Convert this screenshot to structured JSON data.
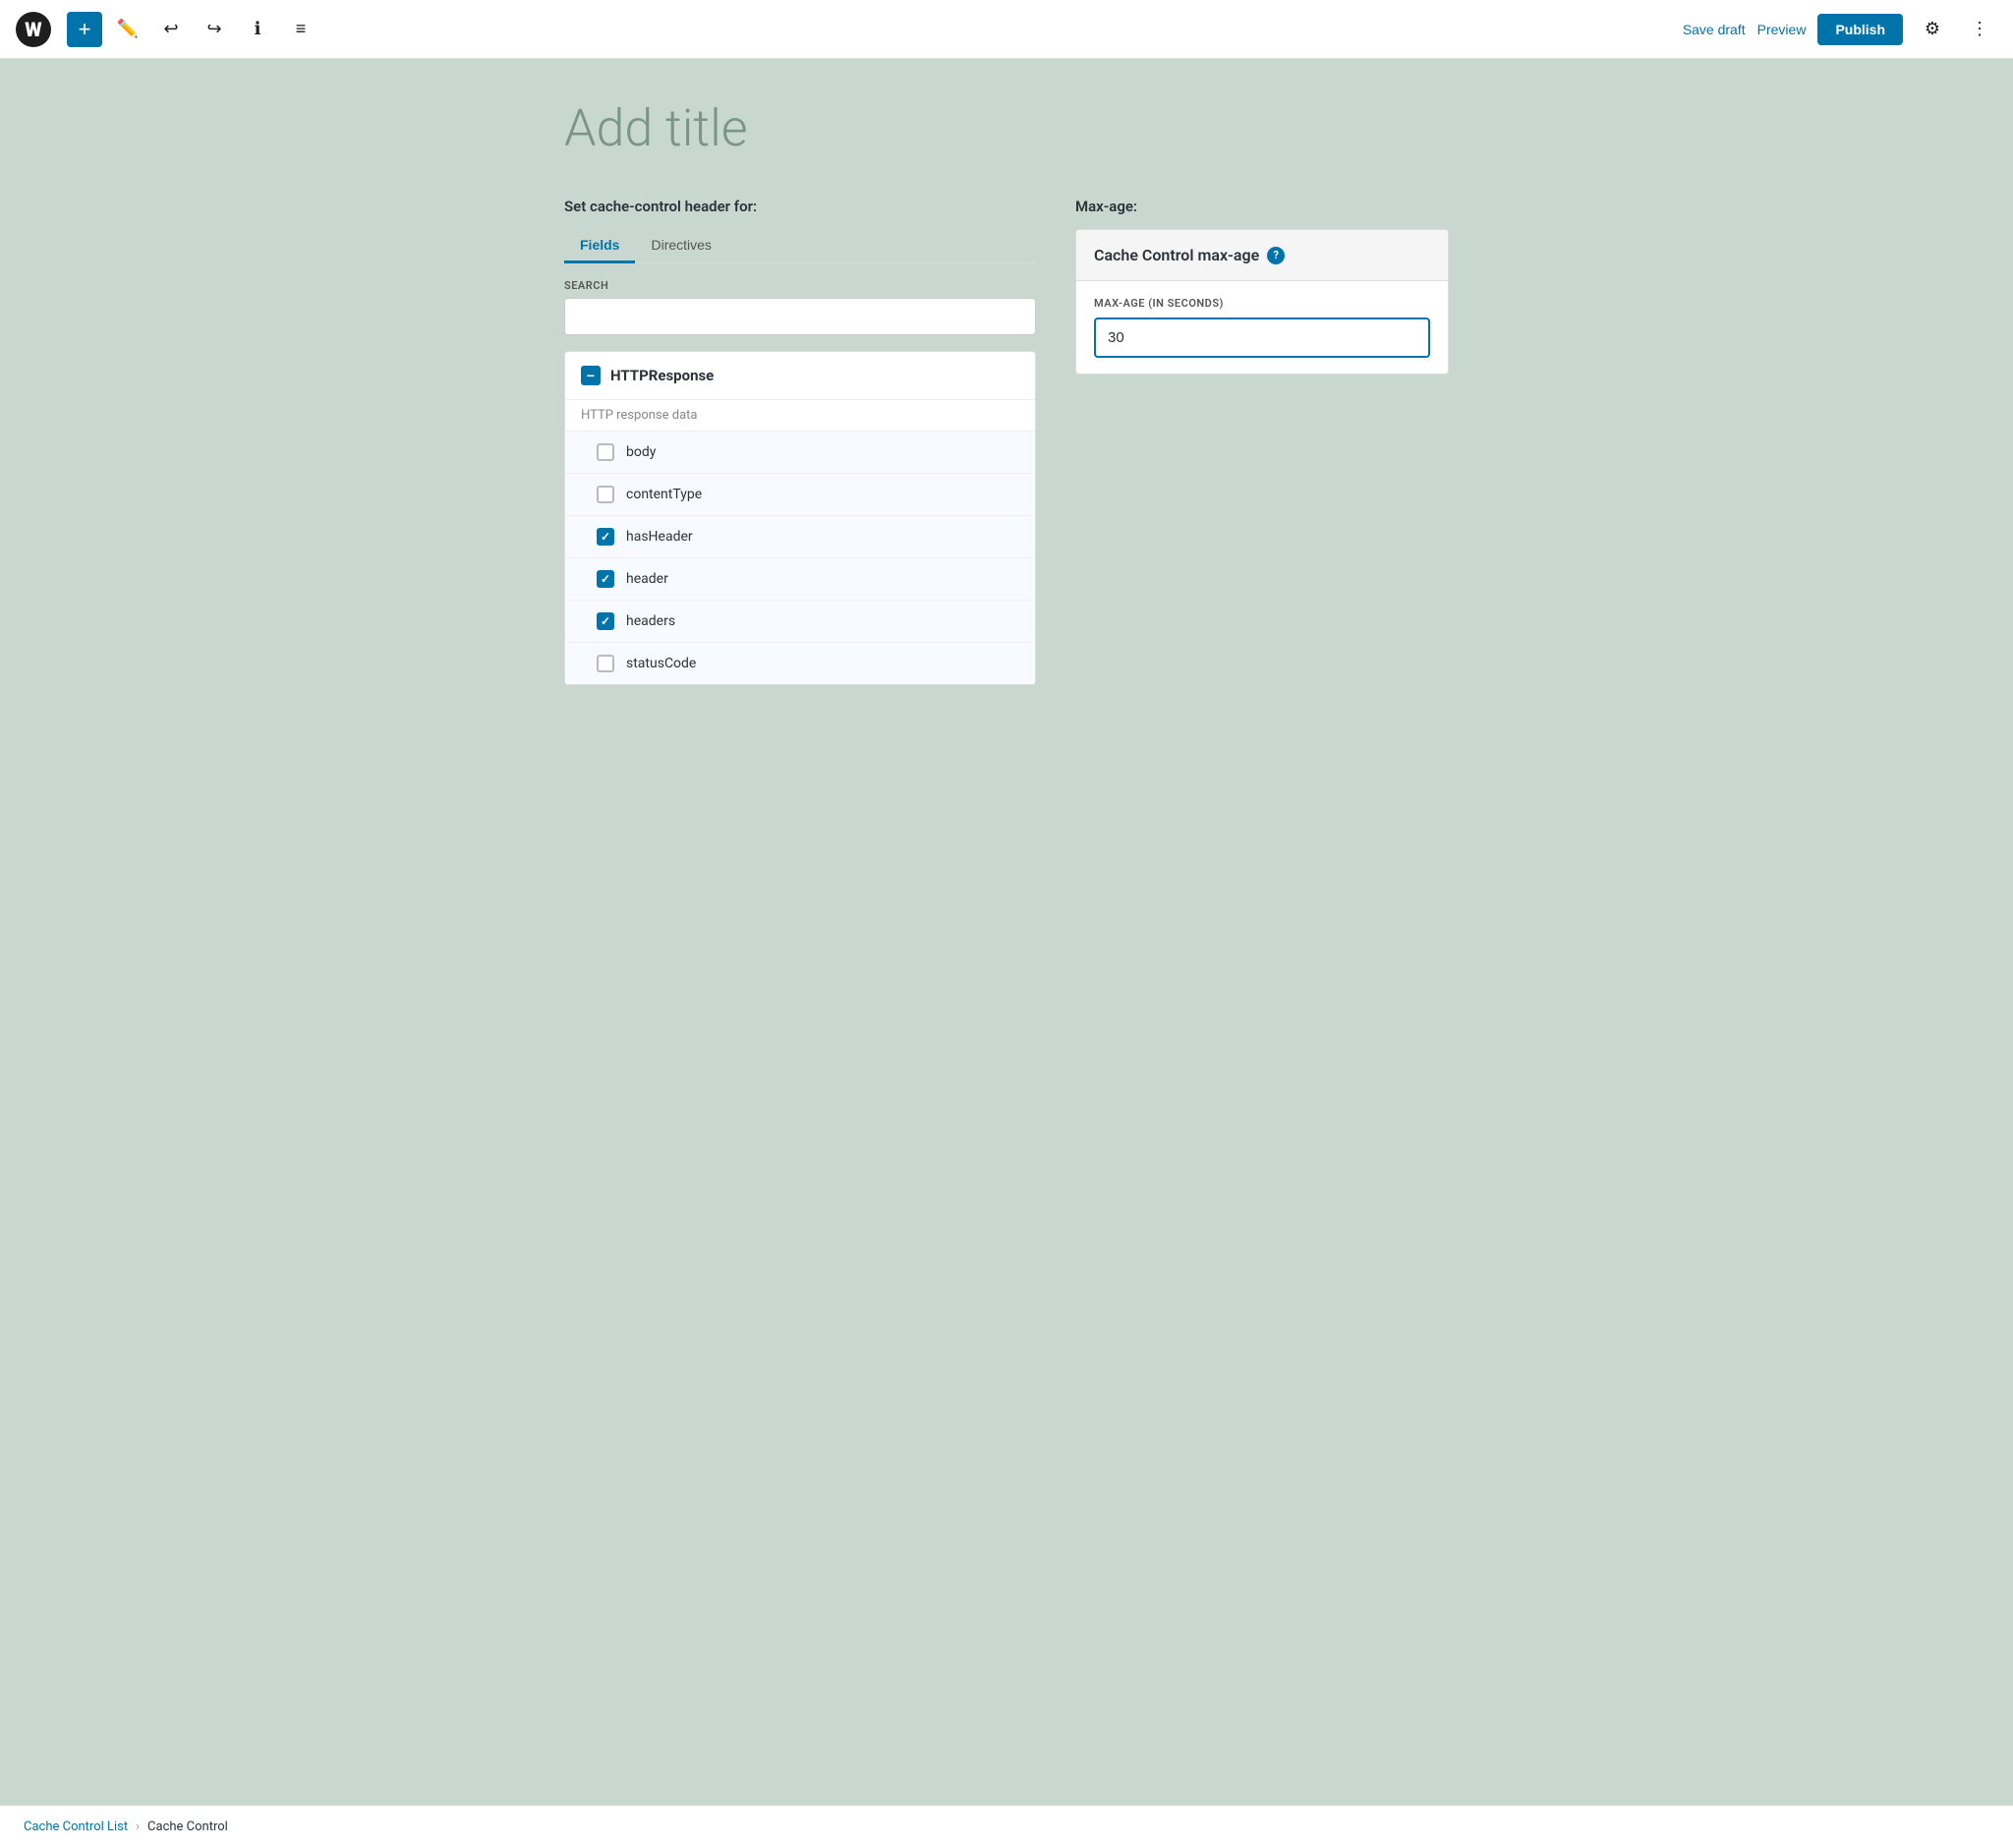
{
  "topbar": {
    "logo_text": "W",
    "add_label": "+",
    "save_draft_label": "Save draft",
    "preview_label": "Preview",
    "publish_label": "Publish"
  },
  "editor": {
    "title_placeholder": "Add title",
    "section_label": "Set cache-control header for:",
    "tabs": [
      {
        "id": "fields",
        "label": "Fields",
        "active": true
      },
      {
        "id": "directives",
        "label": "Directives",
        "active": false
      }
    ],
    "search": {
      "label": "SEARCH",
      "placeholder": ""
    },
    "field_group": {
      "name": "HTTPResponse",
      "description": "HTTP response data",
      "fields": [
        {
          "id": "body",
          "label": "body",
          "checked": false
        },
        {
          "id": "contentType",
          "label": "contentType",
          "checked": false
        },
        {
          "id": "hasHeader",
          "label": "hasHeader",
          "checked": true
        },
        {
          "id": "header",
          "label": "header",
          "checked": true
        },
        {
          "id": "headers",
          "label": "headers",
          "checked": true
        },
        {
          "id": "statusCode",
          "label": "statusCode",
          "checked": false
        }
      ]
    }
  },
  "max_age": {
    "section_label": "Max-age:",
    "card_title": "Cache Control max-age",
    "input_label": "MAX-AGE (IN SECONDS)",
    "input_value": "30"
  },
  "breadcrumb": {
    "items": [
      {
        "label": "Cache Control List",
        "link": true
      },
      {
        "label": "Cache Control",
        "link": false
      }
    ]
  }
}
